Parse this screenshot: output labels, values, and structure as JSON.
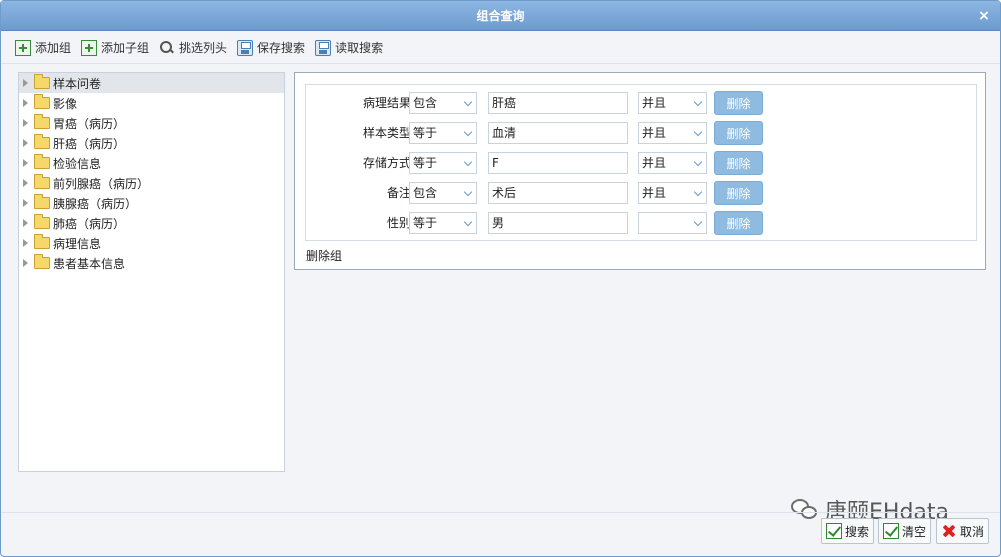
{
  "window": {
    "title": "组合查询",
    "close_label": "×"
  },
  "toolbar": {
    "items": [
      {
        "label": "添加组",
        "icon": "plus-square-icon"
      },
      {
        "label": "添加子组",
        "icon": "plus-square-icon"
      },
      {
        "label": "挑选列头",
        "icon": "search-icon"
      },
      {
        "label": "保存搜索",
        "icon": "save-icon"
      },
      {
        "label": "读取搜索",
        "icon": "save-icon"
      }
    ]
  },
  "tree": {
    "items": [
      {
        "label": "样本问卷",
        "selected": true
      },
      {
        "label": "影像"
      },
      {
        "label": "胃癌（病历）"
      },
      {
        "label": "肝癌（病历）"
      },
      {
        "label": "检验信息"
      },
      {
        "label": "前列腺癌（病历）"
      },
      {
        "label": "胰腺癌（病历）"
      },
      {
        "label": "肺癌（病历）"
      },
      {
        "label": "病理信息"
      },
      {
        "label": "患者基本信息"
      }
    ]
  },
  "conditions": [
    {
      "field": "病理结果",
      "operator": "包含",
      "value": "肝癌",
      "logic": "并且",
      "delete_label": "删除"
    },
    {
      "field": "样本类型",
      "operator": "等于",
      "value": "血清",
      "logic": "并且",
      "delete_label": "删除"
    },
    {
      "field": "存储方式",
      "operator": "等于",
      "value": "F",
      "logic": "并且",
      "delete_label": "删除"
    },
    {
      "field": "备注",
      "operator": "包含",
      "value": "术后",
      "logic": "并且",
      "delete_label": "删除"
    },
    {
      "field": "性别",
      "operator": "等于",
      "value": "男",
      "logic": "",
      "delete_label": "删除"
    }
  ],
  "delete_group_label": "删除组",
  "footer": {
    "search_label": "搜索",
    "clear_label": "清空",
    "cancel_label": "取消"
  },
  "watermark": {
    "text": "唐颐EHdata"
  }
}
